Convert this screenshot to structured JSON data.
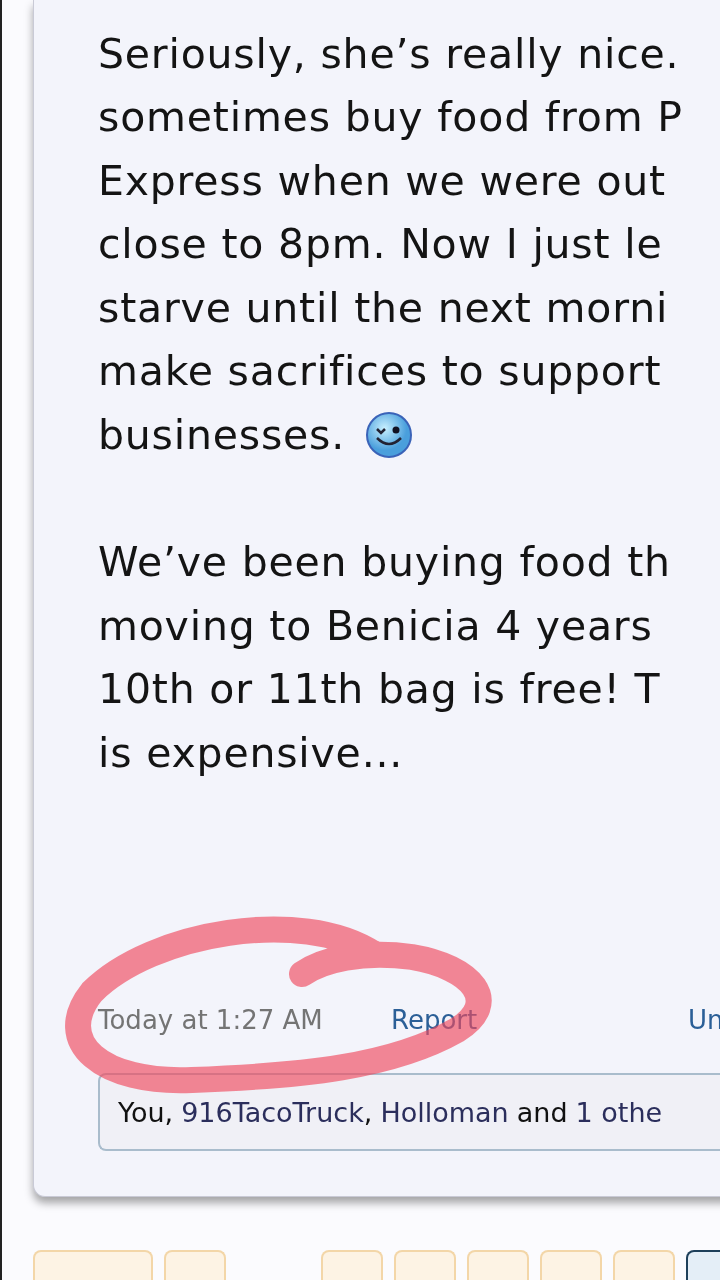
{
  "post": {
    "paragraphs": [
      {
        "lines": [
          "Seriously, she’s really nice.",
          "sometimes buy food from P",
          "Express when we were out",
          "close to 8pm. Now I just le",
          "starve until the next morni",
          "make sacrifices to support",
          "businesses."
        ],
        "kind": "emoticon"
      },
      {
        "lines": [
          "We’ve been buying food th",
          "moving to Benicia 4 years",
          "10th or 11th bag is free! T",
          "is expensive..."
        ],
        "kind": "plain"
      }
    ],
    "timestamp": "Today at 1:27 AM",
    "actions": [
      "Report",
      "Un"
    ],
    "likes": [
      {
        "text": "You,",
        "kind": "plain"
      },
      {
        "text": "916TacoTruck",
        "kind": "user"
      },
      {
        "text": ",",
        "kind": "plain"
      },
      {
        "text": "Holloman",
        "kind": "user"
      },
      {
        "text": "and",
        "kind": "plain"
      },
      {
        "text": "1 othe",
        "kind": "user"
      }
    ]
  },
  "pagination": [
    {
      "kind": "prev",
      "selected": false
    },
    {
      "kind": "page",
      "selected": false
    },
    {
      "kind": "gap"
    },
    {
      "kind": "page",
      "selected": false
    },
    {
      "kind": "page",
      "selected": false
    },
    {
      "kind": "page",
      "selected": false
    },
    {
      "kind": "page",
      "selected": false
    },
    {
      "kind": "page",
      "selected": false
    },
    {
      "kind": "page",
      "selected": true
    }
  ]
}
